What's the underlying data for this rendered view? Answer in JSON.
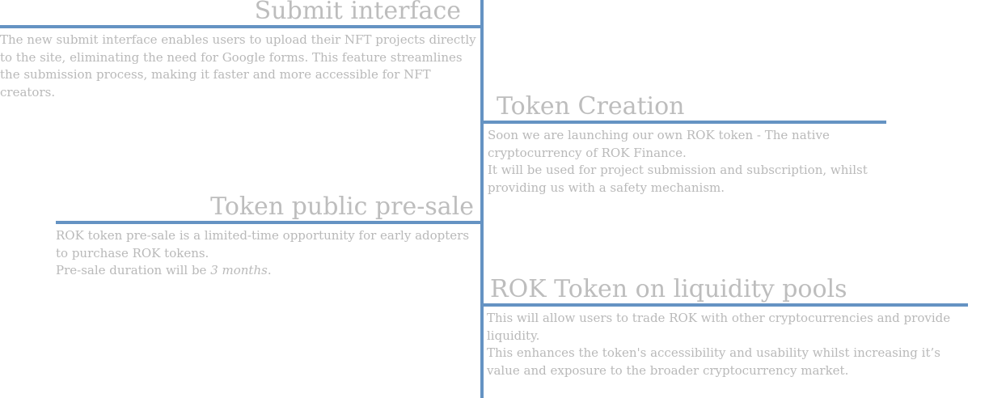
{
  "roadmap": {
    "submit": {
      "title": "Submit interface",
      "body": "The new submit interface enables users to upload their NFT projects directly to the site, eliminating the need for Google forms. This feature streamlines the submission process, making it faster and more accessible for NFT creators."
    },
    "token_creation": {
      "title": "Token Creation",
      "body_1": "Soon we are launching our own ROK token - The native cryptocurrency of ROK Finance.",
      "body_2": "It will be used for project submission and subscription, whilst providing us with a safety mechanism."
    },
    "presale": {
      "title": "Token public pre-sale",
      "body_1": "ROK token pre-sale is a limited-time opportunity for early adopters to purchase ROK tokens.",
      "body_2_prefix": "Pre-sale duration will be ",
      "body_2_emphasis": "3 months",
      "body_2_suffix": "."
    },
    "liquidity": {
      "title": "ROK Token on liquidity pools",
      "body_1": "This will allow users to trade ROK with other cryptocurrencies and provide liquidity.",
      "body_2": "This enhances the token's accessibility and usability whilst increasing it’s value and exposure to the broader cryptocurrency market."
    }
  },
  "colors": {
    "accent": "#6593c3",
    "heading_text": "#bdbdbd",
    "body_text": "#b9b9b9"
  }
}
